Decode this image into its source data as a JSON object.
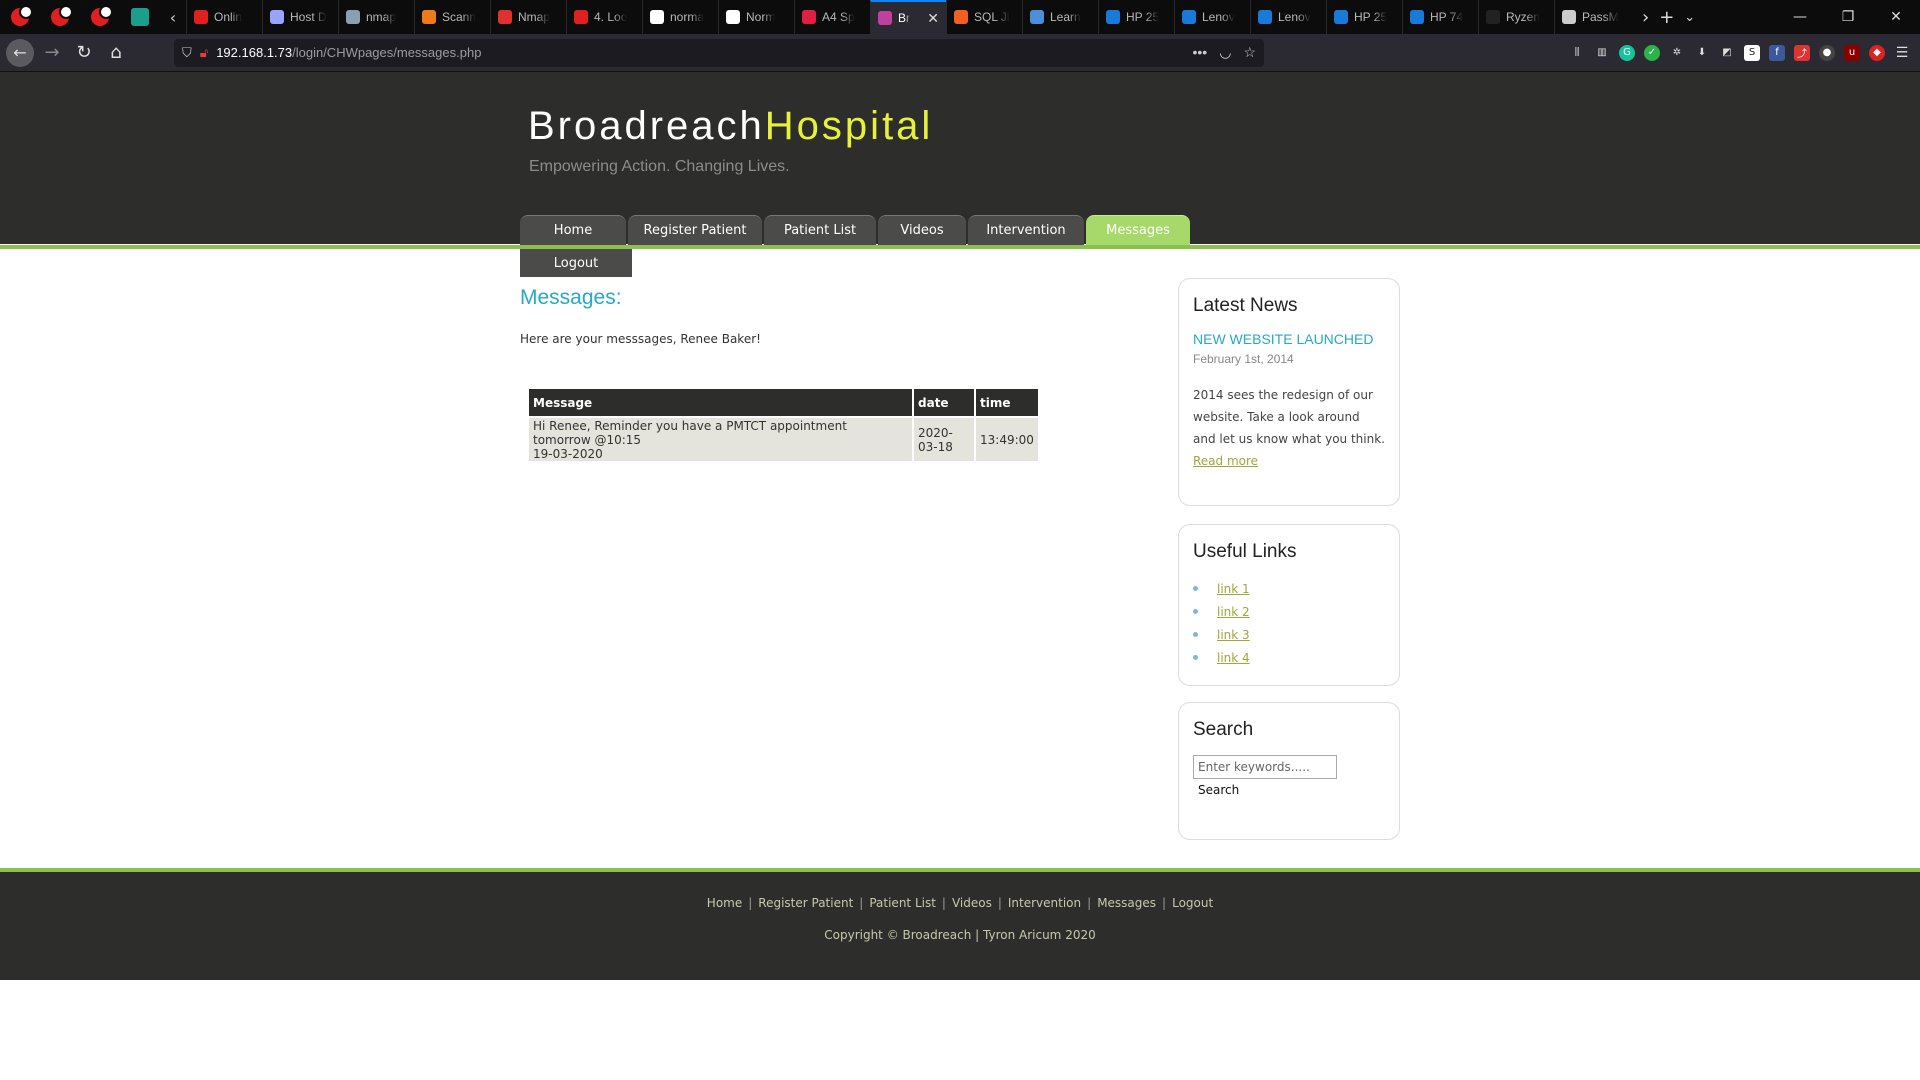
{
  "browser": {
    "pinned_tabs": [
      "",
      "",
      "",
      ""
    ],
    "tabs": [
      {
        "label": "Onlin",
        "color": "#e02020"
      },
      {
        "label": "Host D",
        "color": "#9aa4ff"
      },
      {
        "label": "nmap",
        "color": "#8aa0b0"
      },
      {
        "label": "Scann",
        "color": "#f07a1a"
      },
      {
        "label": "Nmap",
        "color": "#e03030"
      },
      {
        "label": "4. Loo",
        "color": "#e02020"
      },
      {
        "label": "norma",
        "color": "#ffffff"
      },
      {
        "label": "Norm",
        "color": "#ffffff"
      },
      {
        "label": "A4 Sp",
        "color": "#e02040"
      },
      {
        "label": "Br",
        "color": "#c040a0"
      },
      {
        "label": "SQL Ji",
        "color": "#f06020"
      },
      {
        "label": "Learn",
        "color": "#4a90d9"
      },
      {
        "label": "HP 25",
        "color": "#1a7ad9"
      },
      {
        "label": "Lenov",
        "color": "#1a7ad9"
      },
      {
        "label": "Lenov",
        "color": "#1a7ad9"
      },
      {
        "label": "HP 25",
        "color": "#1a7ad9"
      },
      {
        "label": "HP 74",
        "color": "#1a7ad9"
      },
      {
        "label": "Ryzen",
        "color": "#222222"
      },
      {
        "label": "PassM",
        "color": "#cccccc"
      }
    ],
    "active_tab_index": 9,
    "url_host": "192.168.1.73",
    "url_path": "/login/CHWpages/messages.php"
  },
  "site": {
    "brand_part1": "Broadreach",
    "brand_part2": "Hospital",
    "slogan": "Empowering Action. Changing Lives.",
    "menu": [
      {
        "label": "Home",
        "active": false
      },
      {
        "label": "Register Patient",
        "active": false
      },
      {
        "label": "Patient List",
        "active": false
      },
      {
        "label": "Videos",
        "active": false
      },
      {
        "label": "Intervention",
        "active": false
      },
      {
        "label": "Messages",
        "active": true
      }
    ],
    "logout_label": "Logout"
  },
  "content": {
    "title": "Messages:",
    "greeting": "Here are your messsages, Renee Baker!",
    "table_headers": [
      "Message",
      "date",
      "time"
    ],
    "rows": [
      {
        "message_line1": "Hi Renee, Reminder you have a PMTCT appointment tomorrow @10:15",
        "message_line2": "19-03-2020",
        "date": "2020-03-18",
        "time": "13:49:00"
      }
    ]
  },
  "sidebar": {
    "news_title": "Latest News",
    "news_headline": "NEW WEBSITE LAUNCHED",
    "news_date": "February 1st, 2014",
    "news_body": "2014 sees the redesign of our website. Take a look around and let us know what you think.",
    "news_more": "Read more",
    "links_title": "Useful Links",
    "links": [
      "link 1",
      "link 2",
      "link 3",
      "link 4"
    ],
    "search_title": "Search",
    "search_placeholder": "Enter keywords.....",
    "search_button": "Search"
  },
  "footer": {
    "links": [
      "Home",
      "Register Patient",
      "Patient List",
      "Videos",
      "Intervention",
      "Messages",
      "Logout"
    ],
    "copyright": "Copyright © Broadreach  |  Tyron Aricum 2020"
  },
  "colors": {
    "accent_green": "#8cc04d",
    "brand_yellow": "#e6f13a",
    "title_teal": "#26a9c4",
    "header_dark": "#2d2e2c"
  }
}
